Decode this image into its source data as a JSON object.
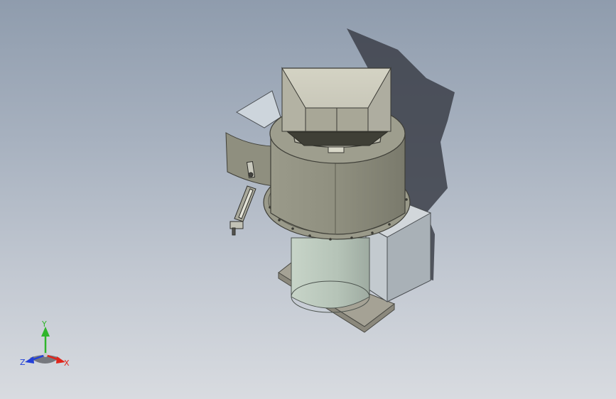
{
  "viewport": {
    "background_top": "#8f9cad",
    "background_bottom": "#d8dbe0"
  },
  "model": {
    "parts": [
      "shadow",
      "base-plate",
      "motor-housing-box",
      "lower-cylinder",
      "bowl-drum",
      "bowl-flange",
      "discharge-chute",
      "hopper",
      "side-bracket-arm"
    ],
    "colors": {
      "drum": "#8e8e7e",
      "hopper": "#c9c8b9",
      "lower_cylinder": "#b9c7bb",
      "box": "#a9b1b7",
      "base": "#a5a295",
      "shadow": "#3c4049"
    }
  },
  "triad": {
    "x_label": "X",
    "y_label": "Y",
    "z_label": "Z",
    "x_color": "#e0251b",
    "y_color": "#2fb52b",
    "z_color": "#2340d8"
  }
}
